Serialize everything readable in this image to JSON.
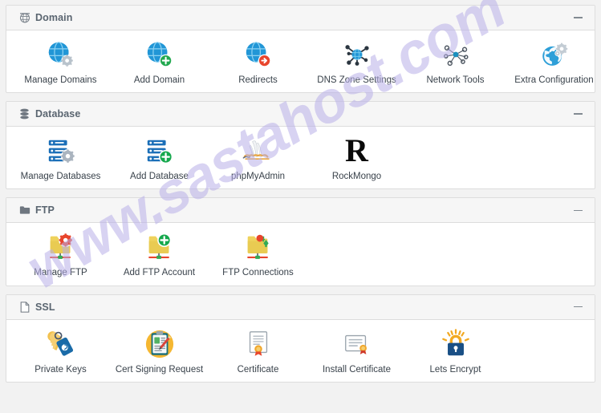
{
  "watermark": {
    "text": "www.sastahost.com",
    "color": "#b9b0e8"
  },
  "collapse_label": "—",
  "panels": [
    {
      "id": "domain",
      "title": "Domain",
      "header_icon": "globe-grid-icon",
      "items": [
        {
          "label": "Manage Domains",
          "icon": "globe-gear-icon"
        },
        {
          "label": "Add Domain",
          "icon": "globe-plus-icon"
        },
        {
          "label": "Redirects",
          "icon": "globe-arrow-icon"
        },
        {
          "label": "DNS Zone Settings",
          "icon": "dns-node-icon"
        },
        {
          "label": "Network Tools",
          "icon": "network-nodes-icon"
        },
        {
          "label": "Extra Configuration",
          "icon": "globe-gears-icon"
        }
      ]
    },
    {
      "id": "database",
      "title": "Database",
      "header_icon": "database-stack-icon",
      "items": [
        {
          "label": "Manage Databases",
          "icon": "database-gear-icon"
        },
        {
          "label": "Add Database",
          "icon": "database-plus-icon"
        },
        {
          "label": "phpMyAdmin",
          "icon": "phpmyadmin-dolphin-icon"
        },
        {
          "label": "RockMongo",
          "icon": "rockmongo-r-icon"
        }
      ]
    },
    {
      "id": "ftp",
      "title": "FTP",
      "header_icon": "folder-icon",
      "items": [
        {
          "label": "Manage FTP",
          "icon": "folder-gear-icon"
        },
        {
          "label": "Add FTP Account",
          "icon": "folder-plus-icon"
        },
        {
          "label": "FTP Connections",
          "icon": "folder-connections-icon"
        }
      ]
    },
    {
      "id": "ssl",
      "title": "SSL",
      "header_icon": "document-icon",
      "items": [
        {
          "label": "Private Keys",
          "icon": "key-icon"
        },
        {
          "label": "Cert Signing Request",
          "icon": "clipboard-pen-icon"
        },
        {
          "label": "Certificate",
          "icon": "certificate-icon"
        },
        {
          "label": "Install Certificate",
          "icon": "install-certificate-icon"
        },
        {
          "label": "Lets Encrypt",
          "icon": "padlock-sun-icon"
        }
      ]
    }
  ]
}
